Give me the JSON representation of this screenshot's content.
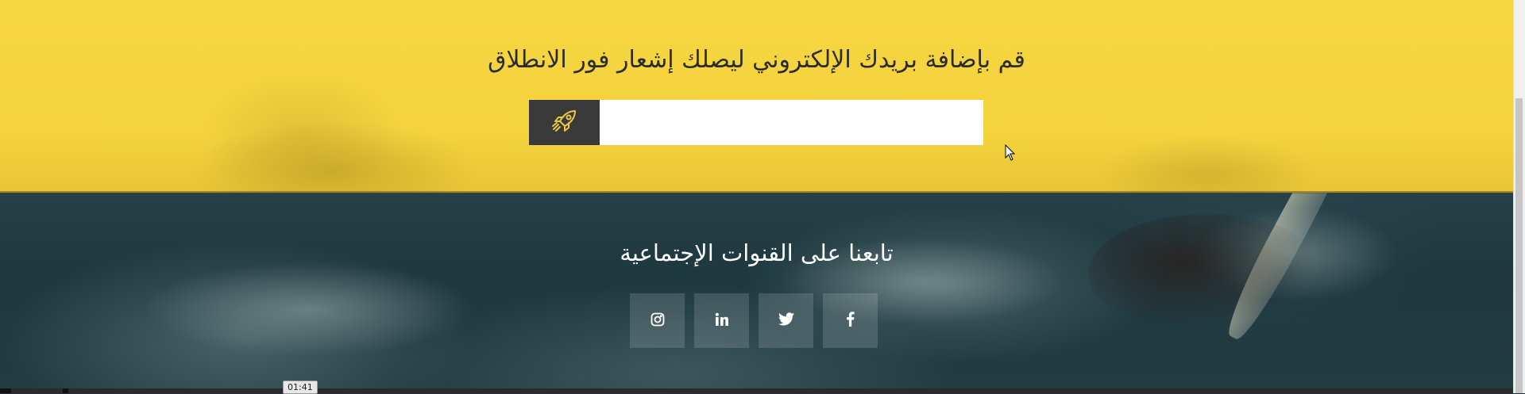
{
  "newsletter": {
    "title": "قم بإضافة بريدك الإلكتروني ليصلك إشعار فور الانطلاق",
    "email_value": "",
    "submit_icon": "rocket-icon"
  },
  "social": {
    "title": "تابعنا على القنوات الإجتماعية",
    "links": [
      {
        "name": "instagram",
        "icon": "instagram-icon"
      },
      {
        "name": "linkedin",
        "icon": "linkedin-icon"
      },
      {
        "name": "twitter",
        "icon": "twitter-icon"
      },
      {
        "name": "facebook",
        "icon": "facebook-icon"
      }
    ]
  },
  "video": {
    "time_tooltip": "01:41"
  },
  "colors": {
    "accent_yellow": "#f4d33e",
    "button_dark": "#3a3a3a",
    "social_tile": "rgba(255,255,255,0.14)"
  }
}
